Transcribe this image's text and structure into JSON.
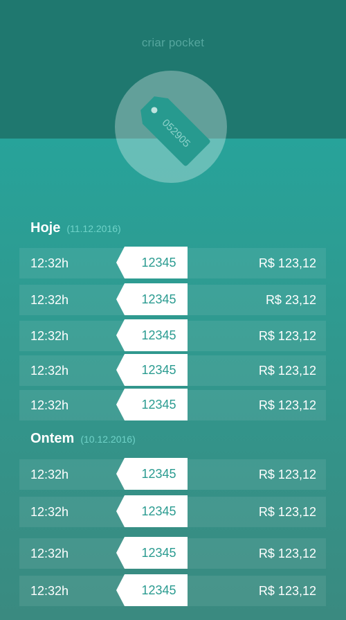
{
  "header": {
    "title": "criar pocket",
    "tag_icon": "price-tag-icon",
    "tag_code": "052905"
  },
  "sections": [
    {
      "name": "Hoje",
      "date": "(11.12.2016)",
      "rows": [
        {
          "time": "12:32h",
          "code": "12345",
          "amount": "R$ 123,12"
        },
        {
          "time": "12:32h",
          "code": "12345",
          "amount": "R$ 23,12"
        },
        {
          "time": "12:32h",
          "code": "12345",
          "amount": "R$ 123,12"
        },
        {
          "time": "12:32h",
          "code": "12345",
          "amount": "R$ 123,12"
        },
        {
          "time": "12:32h",
          "code": "12345",
          "amount": "R$ 123,12"
        }
      ]
    },
    {
      "name": "Ontem",
      "date": "(10.12.2016)",
      "rows": [
        {
          "time": "12:32h",
          "code": "12345",
          "amount": "R$ 123,12"
        },
        {
          "time": "12:32h",
          "code": "12345",
          "amount": "R$ 123,12"
        },
        {
          "time": "12:32h",
          "code": "12345",
          "amount": "R$ 123,12"
        },
        {
          "time": "12:32h",
          "code": "12345",
          "amount": "R$ 123,12"
        }
      ]
    }
  ],
  "colors": {
    "header": "#1f786f",
    "accent": "#27a39a",
    "date": "#6fd2c8",
    "tag_text": "#2a9b90"
  }
}
